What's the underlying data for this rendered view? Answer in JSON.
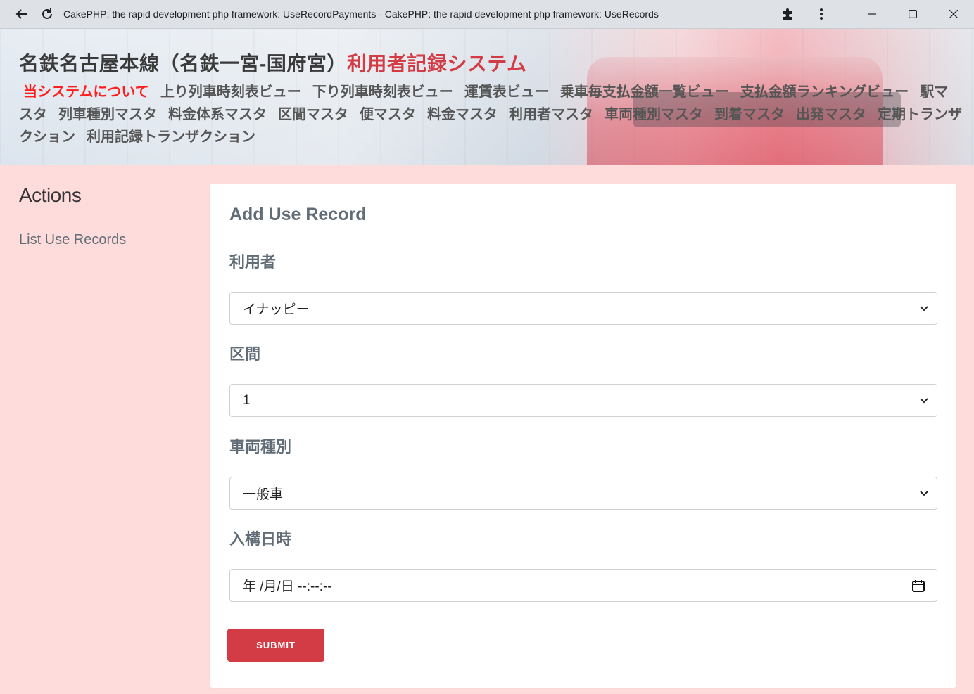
{
  "browser": {
    "tab_title": "CakePHP: the rapid development php framework: UseRecordPayments - CakePHP: the rapid development php framework: UseRecords"
  },
  "header": {
    "title_main": "名鉄名古屋本線（名鉄一宮-国府宮）",
    "title_accent": "利用者記録システム",
    "nav": [
      "当システムについて",
      "上り列車時刻表ビュー",
      "下り列車時刻表ビュー",
      "運賃表ビュー",
      "乗車毎支払金額一覧ビュー",
      "支払金額ランキングビュー",
      "駅マスタ",
      "列車種別マスタ",
      "料金体系マスタ",
      "区間マスタ",
      "便マスタ",
      "料金マスタ",
      "利用者マスタ",
      "車両種別マスタ",
      "到着マスタ",
      "出発マスタ",
      "定期トランザクション",
      "利用記録トランザクション"
    ]
  },
  "sidebar": {
    "heading": "Actions",
    "links": [
      "List Use Records"
    ]
  },
  "form": {
    "title": "Add Use Record",
    "fields": [
      {
        "label": "利用者",
        "value": "イナッピー"
      },
      {
        "label": "区間",
        "value": "1"
      },
      {
        "label": "車両種別",
        "value": "一般車"
      },
      {
        "label": "入構日時",
        "value": "年 /月/日 --:--:--"
      }
    ],
    "submit_label": "SUBMIT"
  },
  "colors": {
    "accent": "#d33c44",
    "page_bg": "#ffdcdc",
    "current_nav": "#ff1e1e"
  }
}
